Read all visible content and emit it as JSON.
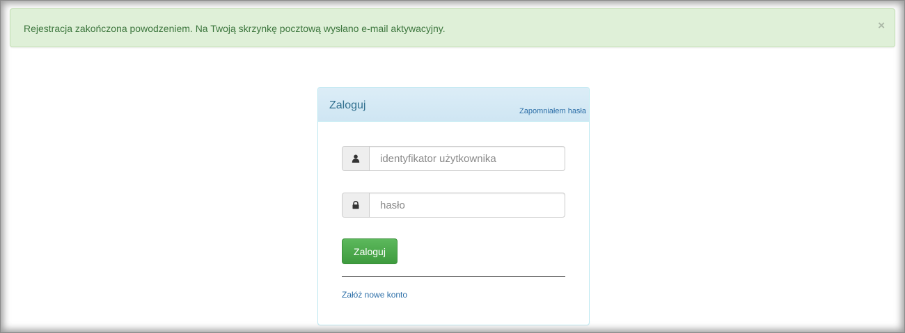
{
  "alert": {
    "message": "Rejestracja zakończona powodzeniem. Na Twoją skrzynkę pocztową wysłano e-mail aktywacyjny.",
    "close_symbol": "×",
    "background_color": "#dff0d8",
    "text_color": "#3c763d"
  },
  "login_panel": {
    "title": "Zaloguj",
    "forgot_password_link": "Zapomniałem hasła",
    "username": {
      "icon": "user-icon",
      "placeholder": "identyfikator użytkownika",
      "value": ""
    },
    "password": {
      "icon": "lock-icon",
      "placeholder": "hasło",
      "value": ""
    },
    "submit_label": "Zaloguj",
    "create_account_link": "Załóż nowe konto",
    "heading_color": "#d9edf7",
    "button_color": "#5cb85c",
    "link_color": "#2d6fa8"
  }
}
